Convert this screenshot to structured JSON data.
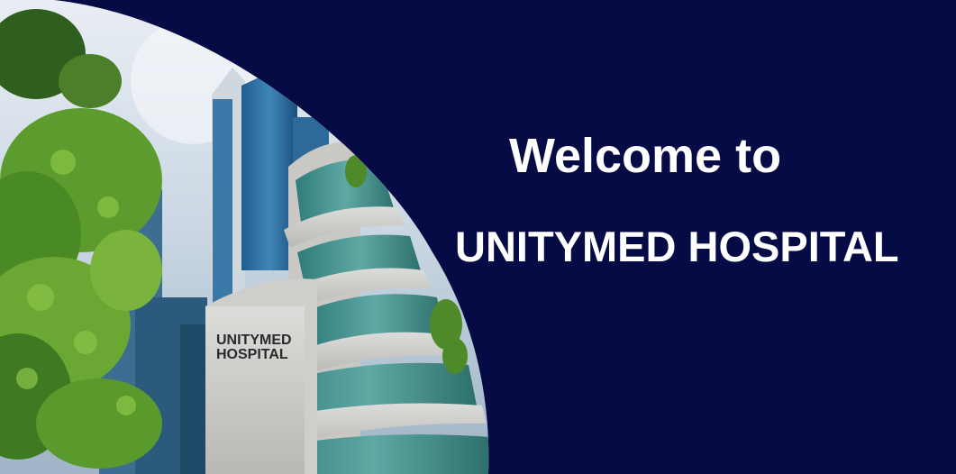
{
  "banner": {
    "heading": "Welcome to",
    "hospital_name": "UNITYMED HOSPITAL",
    "background_color": "#060b45",
    "text_color": "#ffffff"
  },
  "photo": {
    "sign_line1": "UNITYMED",
    "sign_line2": "HOSPITAL"
  }
}
